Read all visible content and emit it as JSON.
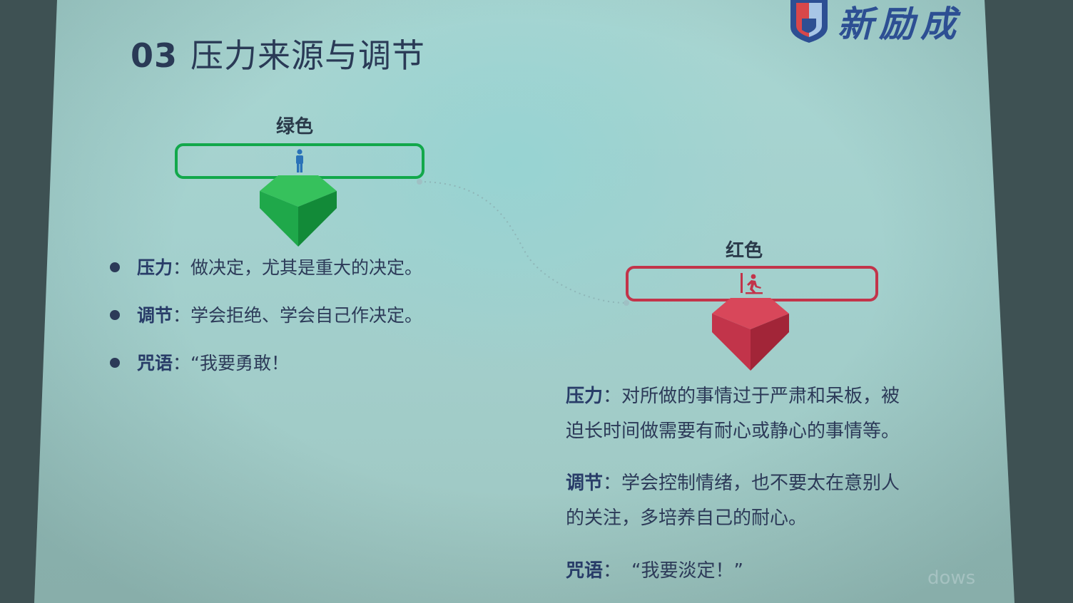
{
  "title": {
    "num": "03",
    "text": "压力来源与调节"
  },
  "logo": {
    "text": "新励成"
  },
  "green": {
    "heading": "绿色",
    "color": "#12a84b",
    "icon": "standing-person-icon",
    "items": [
      {
        "key": "压力",
        "sep": "：",
        "text": "做决定，尤其是重大的决定。"
      },
      {
        "key": "调节",
        "sep": "：",
        "text": "学会拒绝、学会自己作决定。"
      },
      {
        "key": "咒语",
        "sep": "：",
        "text": "“我要勇敢！"
      }
    ]
  },
  "red": {
    "heading": "红色",
    "color": "#c2344a",
    "icon": "running-person-icon",
    "pressure": {
      "key": "压力",
      "sep": "：",
      "line1": "对所做的事情过于严肃和呆板，被",
      "line2": "迫长时间做需要有耐心或静心的事情等。"
    },
    "adjust": {
      "key": "调节",
      "sep": "：",
      "line1": "学会控制情绪，也不要太在意别人",
      "line2": "的关注，多培养自己的耐心。"
    },
    "mantra": {
      "key": "咒语",
      "sep": "：",
      "text": "“我要淡定！”"
    }
  },
  "watermark": "dows"
}
